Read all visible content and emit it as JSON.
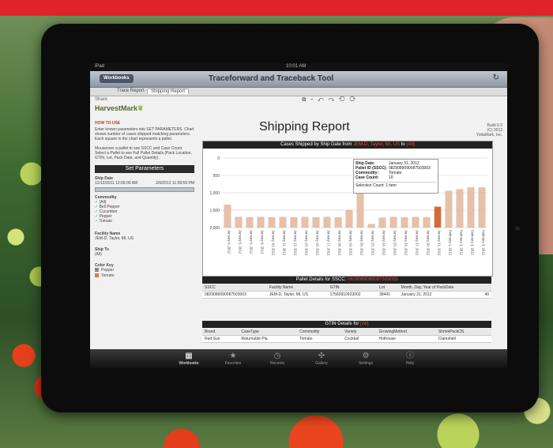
{
  "status_bar": {
    "device": "iPad",
    "time": "10:01 AM"
  },
  "nav": {
    "back_label": "Workbooks",
    "title": "Traceforward and Traceback Tool"
  },
  "tabs": [
    "Trace Report",
    "Shipping Report"
  ],
  "share_label": "Share",
  "brand": {
    "name": "HarvestMark"
  },
  "how_to": {
    "title": "HOW TO USE",
    "text": "Enter known parameters into SET PARAMETERS. Chart shows number of cases shipped matching parameters. Each square in the chart represents a pallet.",
    "text2": "Mouseover a pallet to see SSCC and Case Count. Select a Pallet to see Full Pallet Details (Pack Location, GTIN, Lot, Pack Date, and Quantity)."
  },
  "report": {
    "title": "Shipping Report",
    "build_lines": [
      "Build 9.3",
      "(C) 2012",
      "YottaMark, Inc."
    ]
  },
  "params": {
    "header": "Set Parameters",
    "ship_date_label": "Ship Date",
    "date_from": "12/12/2011 12:00:00 AM",
    "date_to": "2/6/2012 11:59:59 PM",
    "commodity_label": "Commodity",
    "commodities": [
      "(All)",
      "Bell Pepper",
      "Cucumber",
      "Pepper",
      "Tomato"
    ],
    "facility_label": "Facility Name",
    "facility_value": "JEM-D, Taylor, MI, US",
    "ship_to_label": "Ship To",
    "ship_to_value": "(All)",
    "color_key_label": "Color Key",
    "color_key": [
      {
        "name": "Pepper",
        "color": "#7f8c8d"
      },
      {
        "name": "Tomato",
        "color": "#e07a3c"
      }
    ]
  },
  "chart_data": {
    "type": "bar",
    "title": "Cases Shipped by Ship Date from",
    "title_highlight": "JEM-D, Taylor, MI, US",
    "title_tail": "to",
    "title_tail_highlight": "(All)",
    "ylim": [
      0,
      2000
    ],
    "yticks": [
      0,
      500,
      1000,
      1500,
      2000
    ],
    "tick_labels": [
      "2,000",
      "1,500",
      "1,000",
      "500",
      "0"
    ],
    "categories": [
      "January 4, 2012",
      "January 5, 2012",
      "January 6, 2012",
      "January 9, 2012",
      "January 10, 2012",
      "January 11, 2012",
      "January 12, 2012",
      "January 13, 2012",
      "January 16, 2012",
      "January 17, 2012",
      "January 18, 2012",
      "January 19, 2012",
      "January 20, 2012",
      "January 23, 2012",
      "January 24, 2012",
      "January 25, 2012",
      "January 26, 2012",
      "January 27, 2012",
      "January 30, 2012",
      "January 31, 2012",
      "February 1, 2012",
      "February 2, 2012",
      "February 3, 2012",
      "February 6, 2012"
    ],
    "values": [
      650,
      300,
      290,
      300,
      290,
      300,
      290,
      300,
      290,
      300,
      290,
      500,
      1700,
      100,
      280,
      300,
      290,
      300,
      290,
      600,
      1050,
      1100,
      1150,
      1150
    ],
    "tooltip": {
      "ship_date_label": "Ship Date:",
      "ship_date": "January 31, 2012",
      "pallet_label": "Pallet ID (SSCC):",
      "pallet": "0829089090087503003",
      "commodity_label": "Commodity:",
      "commodity": "Tomato",
      "case_count_label": "Case Count:",
      "case_count": "10",
      "selection": "Selection Count: 1 item"
    }
  },
  "pallet_details": {
    "header": "Pallet Details for SSCC:",
    "header_value": "0829089090087503003",
    "columns": [
      "SSCC",
      "Facility Name",
      "GTIN",
      "Lot",
      "Month, Day, Year of PackDate"
    ],
    "row": [
      "0829089090087503003",
      "JEM-D, Taylor, MI, US",
      "17560910923002",
      "38441",
      "January 31, 2012"
    ],
    "count": "40"
  },
  "gtin_details": {
    "header": "GTIN Details for",
    "header_value": "(All)",
    "columns": [
      "Brand",
      "CaseType",
      "Commodity",
      "Variety",
      "GrowingMethod",
      "ShrinkPackOS"
    ],
    "row": [
      "Red Sun",
      "Returnable Pla.",
      "Tomato",
      "Cocktail",
      "Hothouse",
      "Clamshell"
    ],
    "count": "40"
  },
  "tab_bar": [
    {
      "label": "Workbooks",
      "icon": "workbooks-icon",
      "glyph": "▦"
    },
    {
      "label": "Favorites",
      "icon": "star-icon",
      "glyph": "★"
    },
    {
      "label": "Recents",
      "icon": "clock-icon",
      "glyph": "◷"
    },
    {
      "label": "Gallery",
      "icon": "gallery-icon",
      "glyph": "✣"
    },
    {
      "label": "Settings",
      "icon": "gear-icon",
      "glyph": "⚙"
    },
    {
      "label": "Help",
      "icon": "info-icon",
      "glyph": "ⓘ"
    }
  ]
}
